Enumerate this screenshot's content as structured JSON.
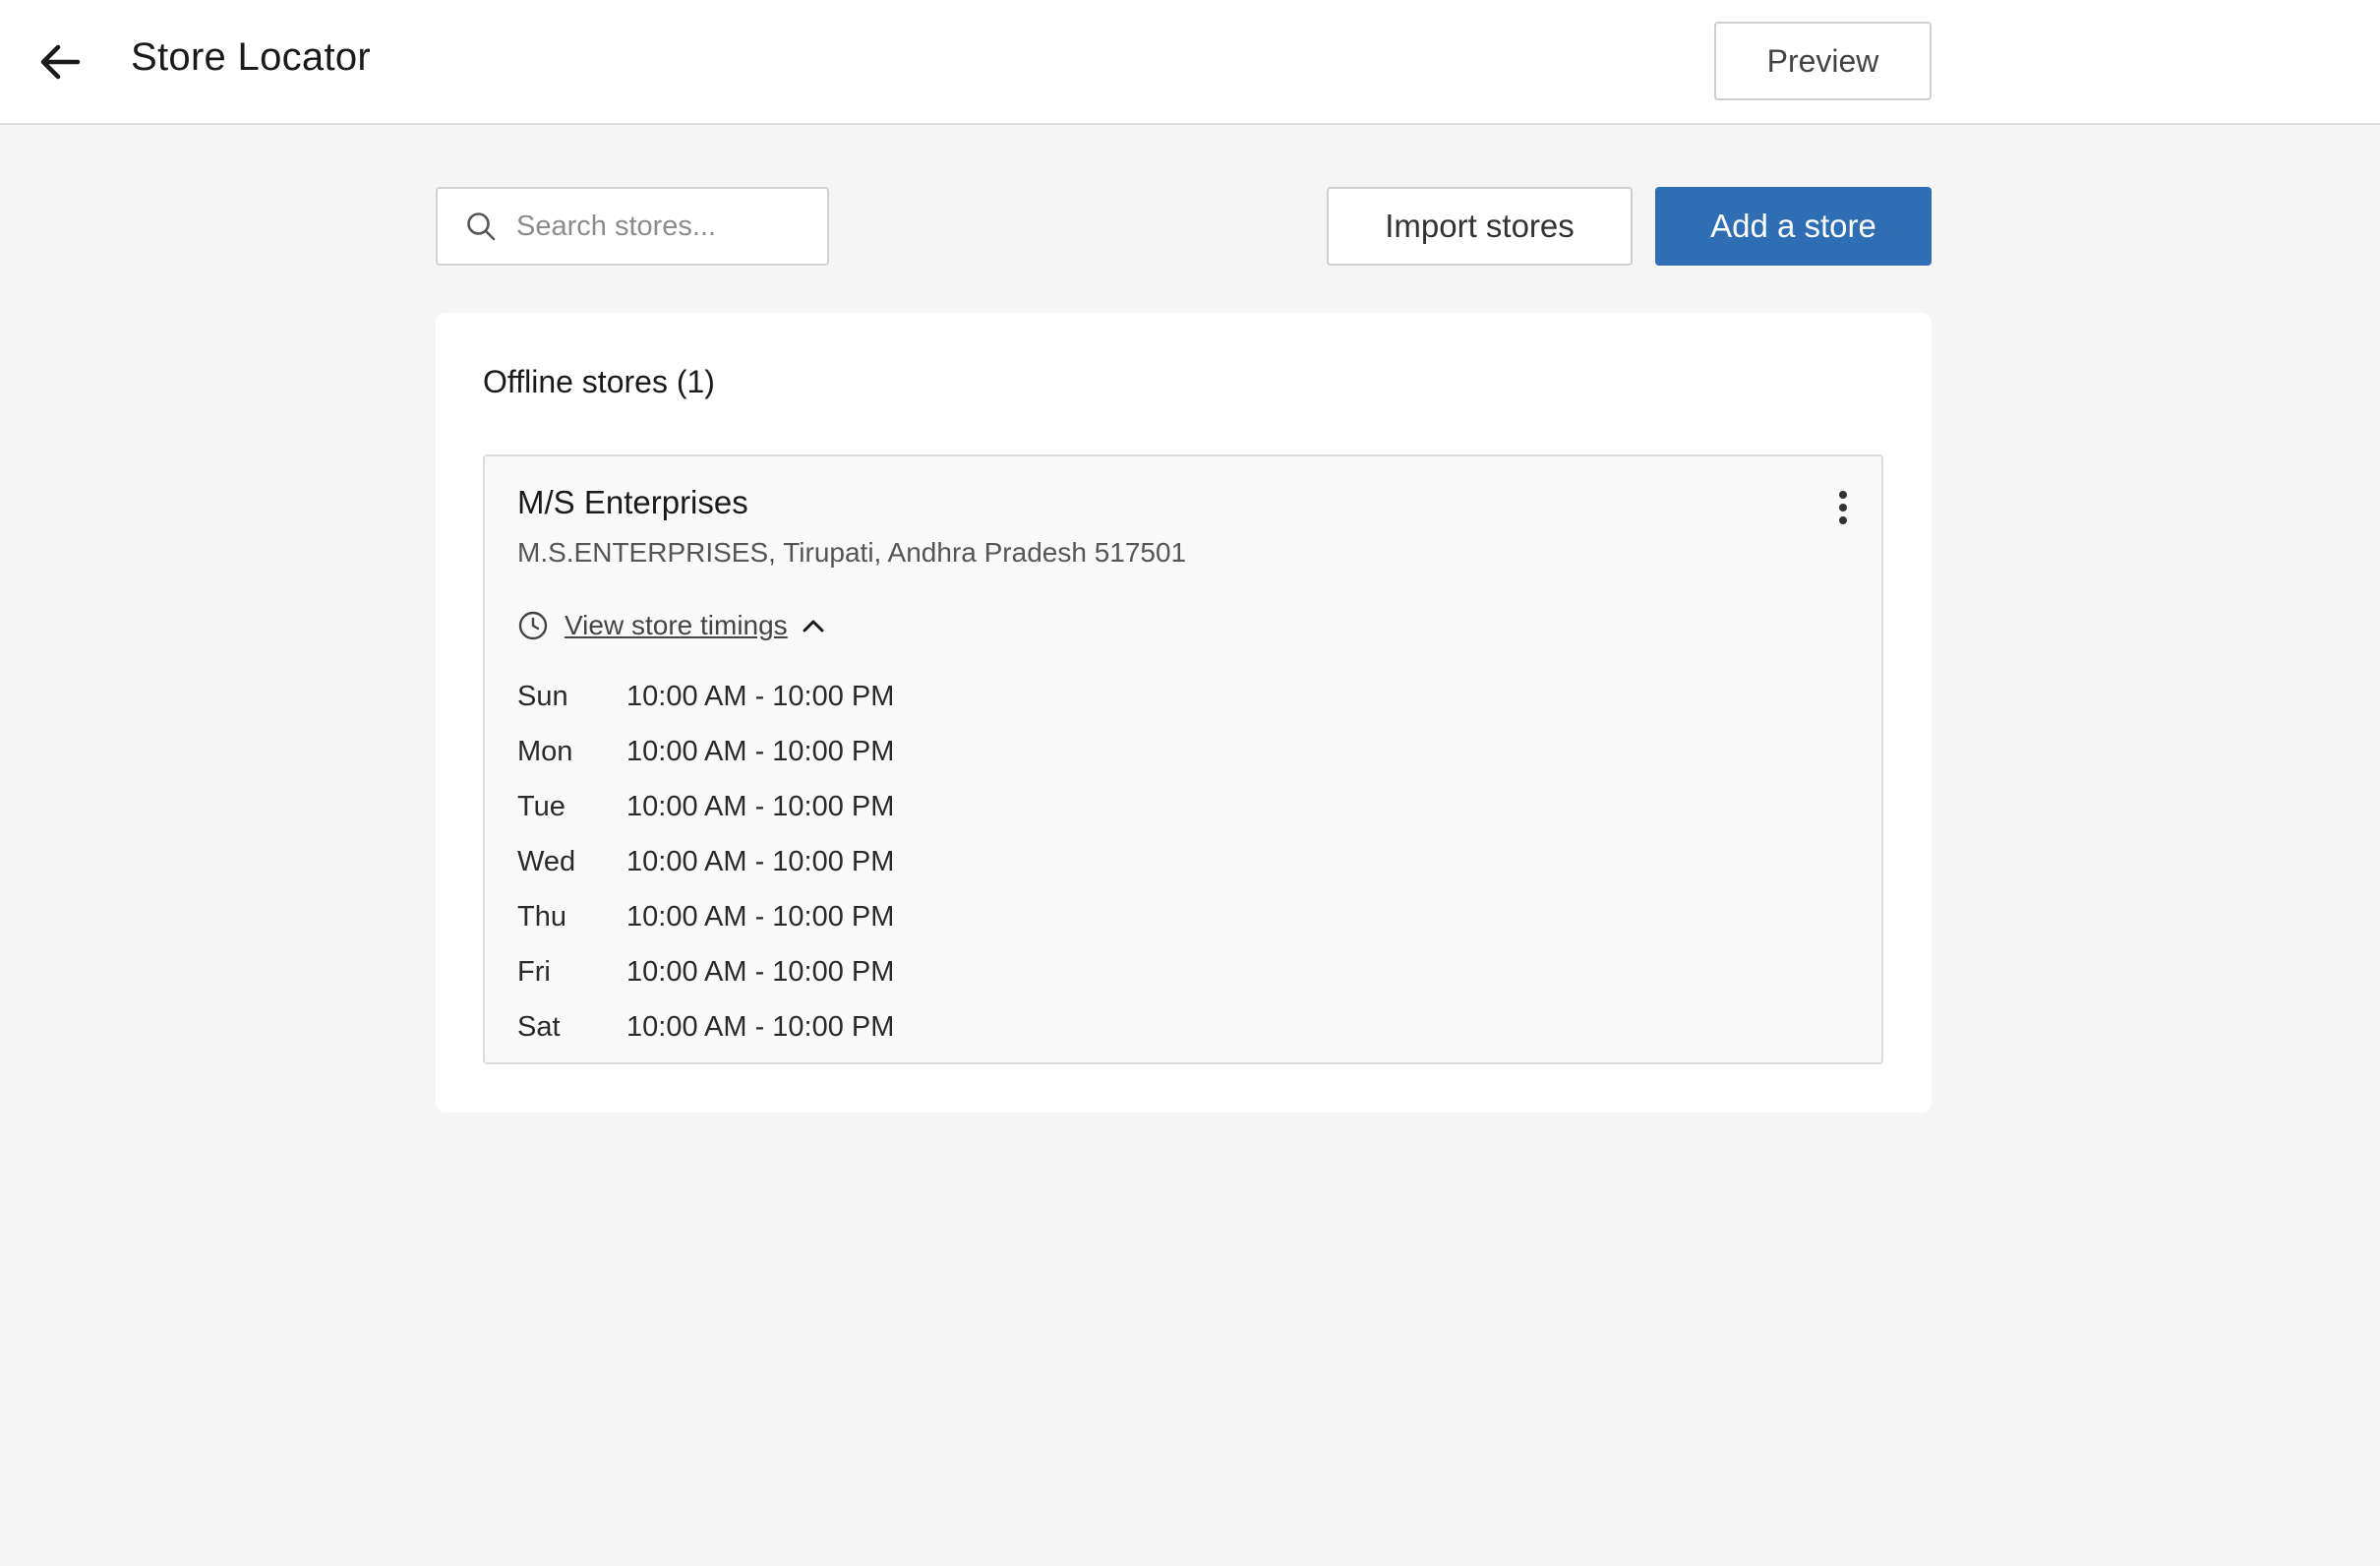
{
  "header": {
    "title": "Store Locator",
    "preview_label": "Preview"
  },
  "toolbar": {
    "search_placeholder": "Search stores...",
    "import_label": "Import stores",
    "add_label": "Add a store"
  },
  "stores_panel": {
    "title": "Offline stores (1)",
    "stores": [
      {
        "name": "M/S Enterprises",
        "address": "M.S.ENTERPRISES, Tirupati, Andhra Pradesh  517501",
        "timings_label": "View store timings",
        "hours": [
          {
            "day": "Sun",
            "time": "10:00 AM - 10:00 PM"
          },
          {
            "day": "Mon",
            "time": "10:00 AM - 10:00 PM"
          },
          {
            "day": "Tue",
            "time": "10:00 AM - 10:00 PM"
          },
          {
            "day": "Wed",
            "time": "10:00 AM - 10:00 PM"
          },
          {
            "day": "Thu",
            "time": "10:00 AM - 10:00 PM"
          },
          {
            "day": "Fri",
            "time": "10:00 AM - 10:00 PM"
          },
          {
            "day": "Sat",
            "time": "10:00 AM - 10:00 PM"
          }
        ]
      }
    ]
  },
  "icons": {
    "back": "arrow-left-icon",
    "search": "search-icon",
    "clock": "clock-icon",
    "chevron": "chevron-up-icon",
    "menu": "more-vertical-icon"
  },
  "colors": {
    "primary": "#2f6db5",
    "background": "#f5f5f5",
    "surface": "#ffffff"
  }
}
